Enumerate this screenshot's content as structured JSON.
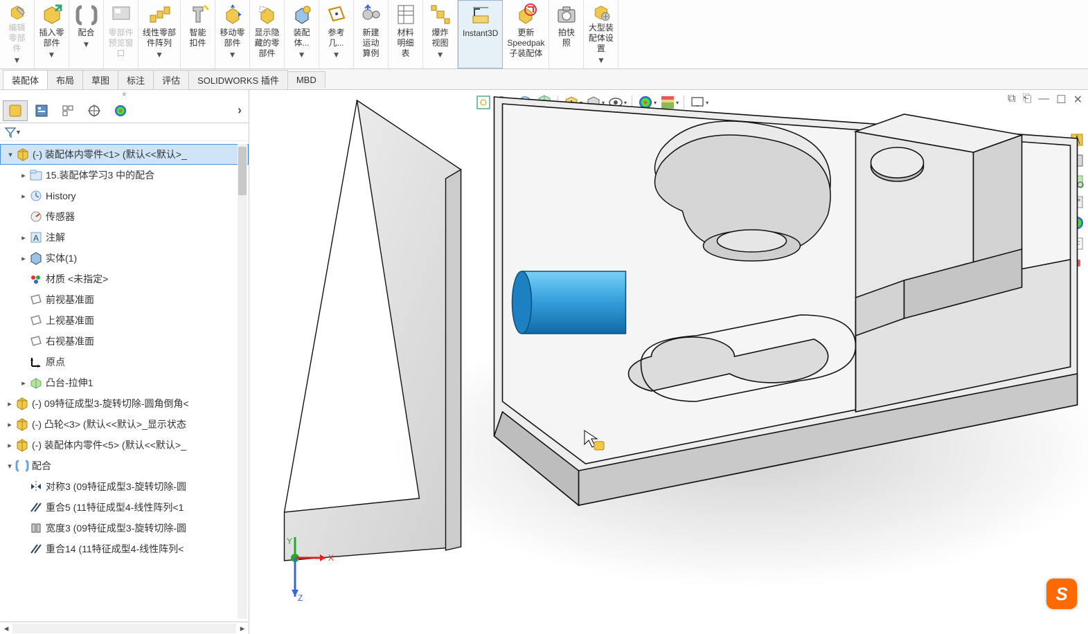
{
  "ribbon": [
    {
      "id": "edit-part",
      "l": "编辑\n零部\n件",
      "dis": true,
      "dd": true
    },
    {
      "id": "insert-component",
      "l": "插入零\n部件",
      "dd": true
    },
    {
      "id": "mate",
      "l": "配合",
      "dd": true
    },
    {
      "id": "component-preview",
      "l": "零部件\n预览窗\n口",
      "dis": true
    },
    {
      "id": "linear-pattern",
      "l": "线性零部\n件阵列",
      "dd": true
    },
    {
      "id": "smart-fasteners",
      "l": "智能\n扣件"
    },
    {
      "id": "move-component",
      "l": "移动零\n部件",
      "dd": true
    },
    {
      "id": "show-hidden",
      "l": "显示隐\n藏的零\n部件"
    },
    {
      "id": "assembly-features",
      "l": "装配\n体...",
      "dd": true
    },
    {
      "id": "reference-geometry",
      "l": "参考\n几...",
      "dd": true
    },
    {
      "id": "new-motion",
      "l": "新建\n运动\n算例"
    },
    {
      "id": "bom",
      "l": "材料\n明细\n表"
    },
    {
      "id": "exploded-view",
      "l": "爆炸\n视图",
      "dd": true
    },
    {
      "id": "instant3d",
      "l": "Instant3D",
      "active": true
    },
    {
      "id": "update-speedpak",
      "l": "更新\nSpeedpak\n子装配体",
      "wide": true
    },
    {
      "id": "snapshot",
      "l": "拍快\n照"
    },
    {
      "id": "large-assembly",
      "l": "大型装\n配体设\n置",
      "dd": true
    }
  ],
  "cmtabs": [
    {
      "id": "assembly",
      "l": "装配体",
      "active": true
    },
    {
      "id": "layout",
      "l": "布局"
    },
    {
      "id": "sketch",
      "l": "草图"
    },
    {
      "id": "annotate",
      "l": "标注"
    },
    {
      "id": "evaluate",
      "l": "评估"
    },
    {
      "id": "swaddins",
      "l": "SOLIDWORKS 插件"
    },
    {
      "id": "mbd",
      "l": "MBD"
    }
  ],
  "tree": [
    {
      "tw": "▾",
      "ind": 0,
      "ico": "part-y",
      "txt": "(-) 装配体内零件<1> (默认<<默认>_",
      "sel": true
    },
    {
      "tw": "▸",
      "ind": 1,
      "ico": "folder",
      "txt": "15.装配体学习3 中的配合"
    },
    {
      "tw": "▸",
      "ind": 1,
      "ico": "history",
      "txt": "History"
    },
    {
      "tw": "",
      "ind": 1,
      "ico": "sensor",
      "txt": "传感器"
    },
    {
      "tw": "▸",
      "ind": 1,
      "ico": "annot",
      "txt": "注解"
    },
    {
      "tw": "▸",
      "ind": 1,
      "ico": "solid",
      "txt": "实体(1)"
    },
    {
      "tw": "",
      "ind": 1,
      "ico": "material",
      "txt": "材质 <未指定>"
    },
    {
      "tw": "",
      "ind": 1,
      "ico": "plane",
      "txt": "前视基准面"
    },
    {
      "tw": "",
      "ind": 1,
      "ico": "plane",
      "txt": "上视基准面"
    },
    {
      "tw": "",
      "ind": 1,
      "ico": "plane",
      "txt": "右视基准面"
    },
    {
      "tw": "",
      "ind": 1,
      "ico": "origin",
      "txt": "原点"
    },
    {
      "tw": "▸",
      "ind": 1,
      "ico": "extrude",
      "txt": "凸台-拉伸1"
    },
    {
      "tw": "▸",
      "ind": 0,
      "ico": "part-y",
      "txt": "(-) 09特征成型3-旋转切除-圆角倒角<"
    },
    {
      "tw": "▸",
      "ind": 0,
      "ico": "part-y",
      "txt": "(-) 凸轮<3> (默认<<默认>_显示状态"
    },
    {
      "tw": "▸",
      "ind": 0,
      "ico": "part-y",
      "txt": "(-) 装配体内零件<5> (默认<<默认>_"
    },
    {
      "tw": "▾",
      "ind": 0,
      "ico": "mates",
      "txt": "配合"
    },
    {
      "tw": "",
      "ind": 1,
      "ico": "sym",
      "txt": "对称3 (09特征成型3-旋转切除-圆"
    },
    {
      "tw": "",
      "ind": 1,
      "ico": "coinc",
      "txt": "重合5 (11特征成型4-线性阵列<1"
    },
    {
      "tw": "",
      "ind": 1,
      "ico": "width",
      "txt": "宽度3 (09特征成型3-旋转切除-圆"
    },
    {
      "tw": "",
      "ind": 1,
      "ico": "coinc",
      "txt": "重合14 (11特征成型4-线性阵列<"
    }
  ],
  "axes": {
    "x": "X",
    "y": "Y",
    "z": "Z"
  }
}
